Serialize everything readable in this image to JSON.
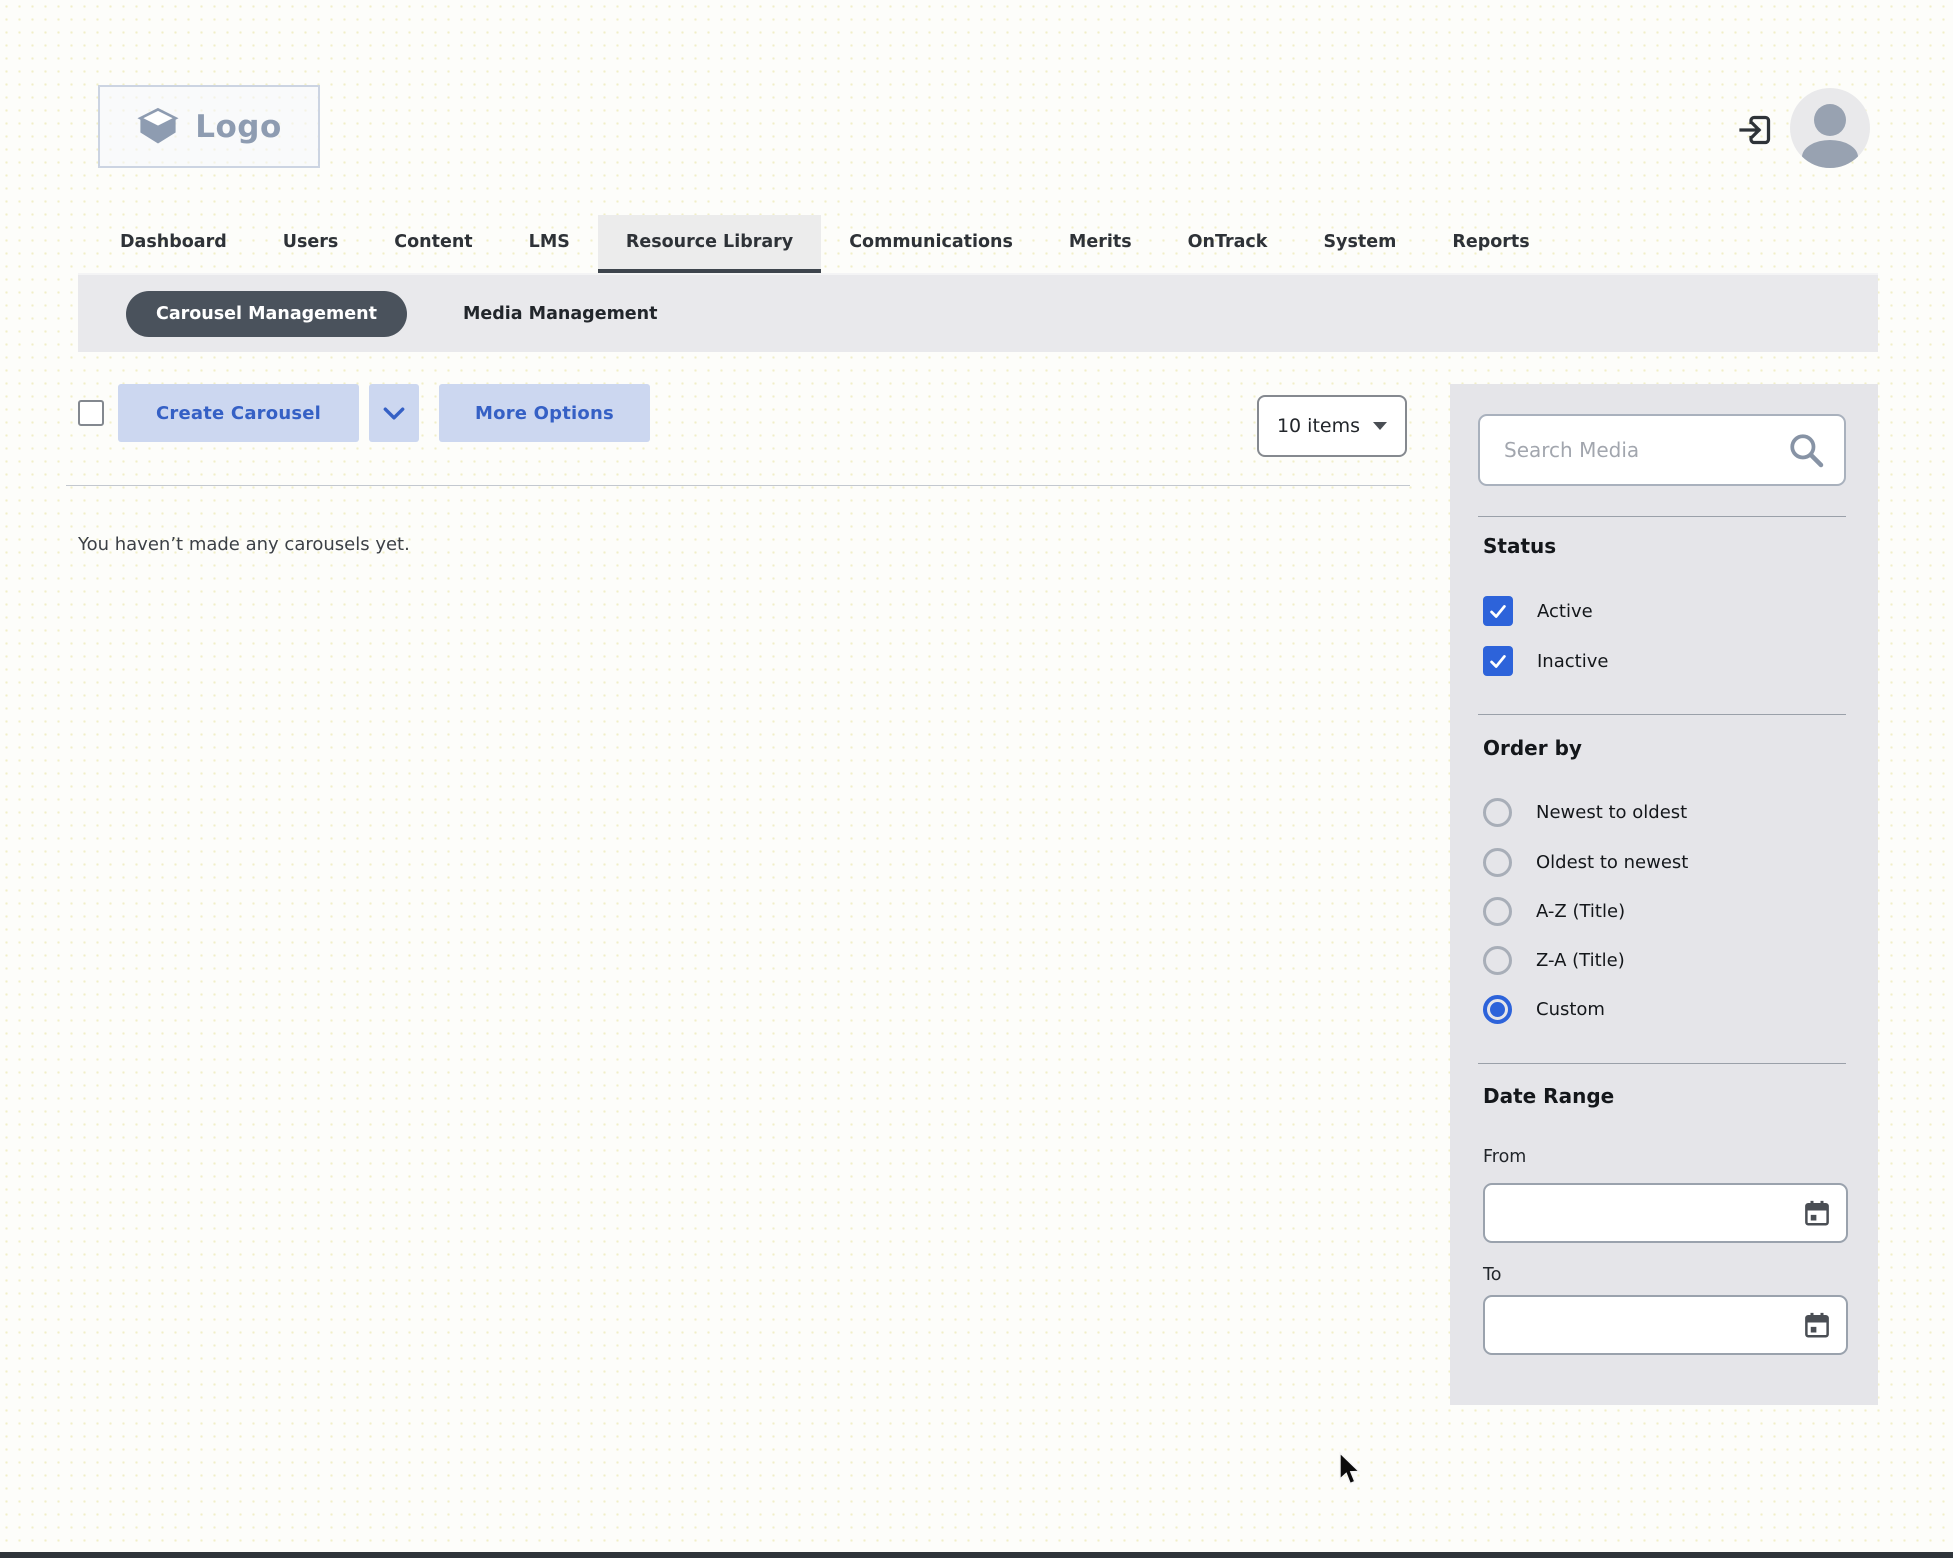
{
  "header": {
    "logo_text": "Logo"
  },
  "nav": {
    "tabs": [
      {
        "label": "Dashboard",
        "active": false
      },
      {
        "label": "Users",
        "active": false
      },
      {
        "label": "Content",
        "active": false
      },
      {
        "label": "LMS",
        "active": false
      },
      {
        "label": "Resource Library",
        "active": true
      },
      {
        "label": "Communications",
        "active": false
      },
      {
        "label": "Merits",
        "active": false
      },
      {
        "label": "OnTrack",
        "active": false
      },
      {
        "label": "System",
        "active": false
      },
      {
        "label": "Reports",
        "active": false
      }
    ]
  },
  "subnav": {
    "items": [
      {
        "label": "Carousel Management",
        "active": true
      },
      {
        "label": "Media Management",
        "active": false
      }
    ]
  },
  "toolbar": {
    "create_button_label": "Create Carousel",
    "more_options_label": "More Options",
    "items_dropdown_label": "10 items"
  },
  "main": {
    "empty_message": "You haven’t made any carousels yet."
  },
  "sidebar": {
    "search": {
      "placeholder": "Search Media",
      "value": ""
    },
    "status": {
      "heading": "Status",
      "options": [
        {
          "label": "Active",
          "checked": true
        },
        {
          "label": "Inactive",
          "checked": true
        }
      ]
    },
    "order_by": {
      "heading": "Order by",
      "options": [
        {
          "label": "Newest to oldest",
          "selected": false
        },
        {
          "label": "Oldest to newest",
          "selected": false
        },
        {
          "label": "A-Z (Title)",
          "selected": false
        },
        {
          "label": "Z-A (Title)",
          "selected": false
        },
        {
          "label": "Custom",
          "selected": true
        }
      ]
    },
    "date_range": {
      "heading": "Date Range",
      "from_label": "From",
      "from_value": "",
      "to_label": "To",
      "to_value": ""
    }
  },
  "colors": {
    "accent_blue": "#2d63da",
    "button_bg": "#ccd7f0",
    "button_text": "#3560c5",
    "pill_bg": "#4a525c",
    "nav_active_underline": "#3e454d",
    "sidebar_bg": "#e5e5e9"
  }
}
